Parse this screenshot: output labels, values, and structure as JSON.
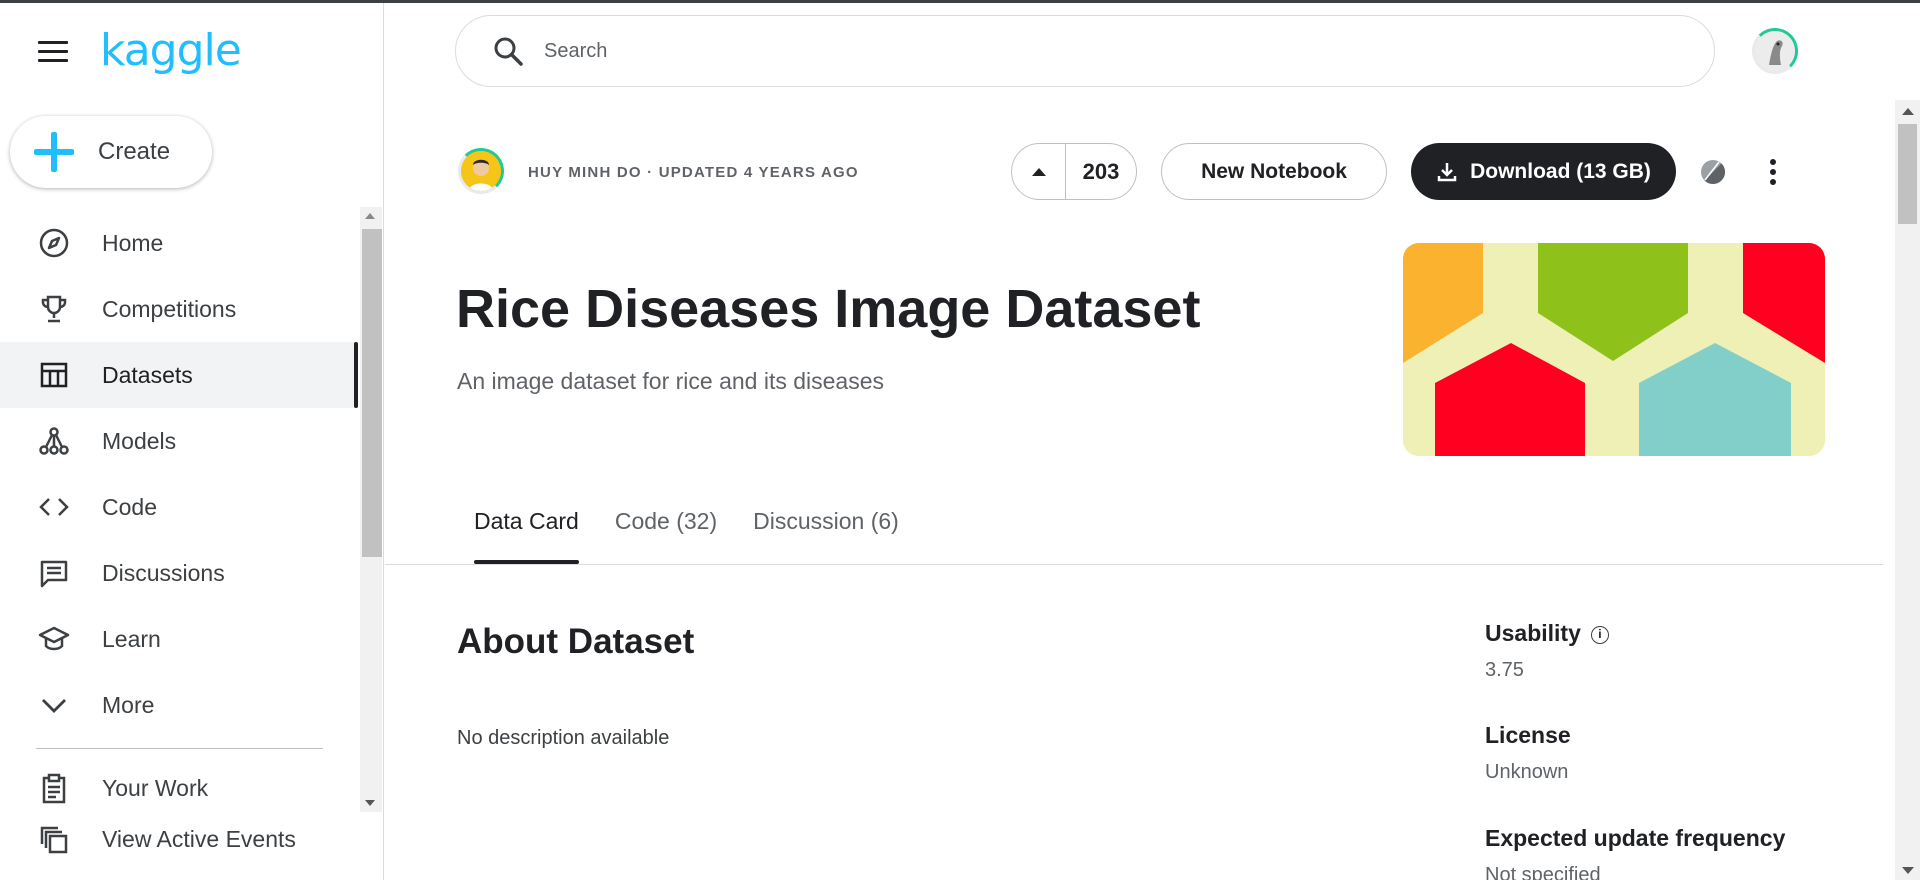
{
  "app": {
    "logo_text": "kaggle"
  },
  "sidebar": {
    "create_label": "Create",
    "items": [
      {
        "label": "Home",
        "icon": "compass-icon"
      },
      {
        "label": "Competitions",
        "icon": "trophy-icon"
      },
      {
        "label": "Datasets",
        "icon": "table-icon",
        "active": true
      },
      {
        "label": "Models",
        "icon": "models-icon"
      },
      {
        "label": "Code",
        "icon": "code-icon"
      },
      {
        "label": "Discussions",
        "icon": "comments-icon"
      },
      {
        "label": "Learn",
        "icon": "graduation-cap-icon"
      },
      {
        "label": "More",
        "icon": "chevron-down-icon"
      }
    ],
    "lower_items": [
      {
        "label": "Your Work",
        "icon": "clipboard-icon"
      },
      {
        "label": "View Active Events",
        "icon": "stack-icon"
      }
    ]
  },
  "search": {
    "placeholder": "Search"
  },
  "dataset": {
    "owner_line": "HUY MINH DO · UPDATED 4 YEARS AGO",
    "vote_count": "203",
    "new_notebook_label": "New Notebook",
    "download_label": "Download (13 GB)",
    "title": "Rice Diseases Image Dataset",
    "subtitle": "An image dataset for rice and its diseases",
    "cover_colors": [
      "#eef0b5",
      "#fbb22e",
      "#8ec21b",
      "#ff0020",
      "#81cfc8"
    ]
  },
  "tabs": [
    {
      "label": "Data Card",
      "active": true
    },
    {
      "label": "Code (32)"
    },
    {
      "label": "Discussion (6)"
    }
  ],
  "about": {
    "heading": "About Dataset",
    "description": "No description available"
  },
  "meta": {
    "usability_label": "Usability",
    "usability_value": "3.75",
    "license_label": "License",
    "license_value": "Unknown",
    "frequency_label": "Expected update frequency",
    "frequency_value": "Not specified"
  }
}
